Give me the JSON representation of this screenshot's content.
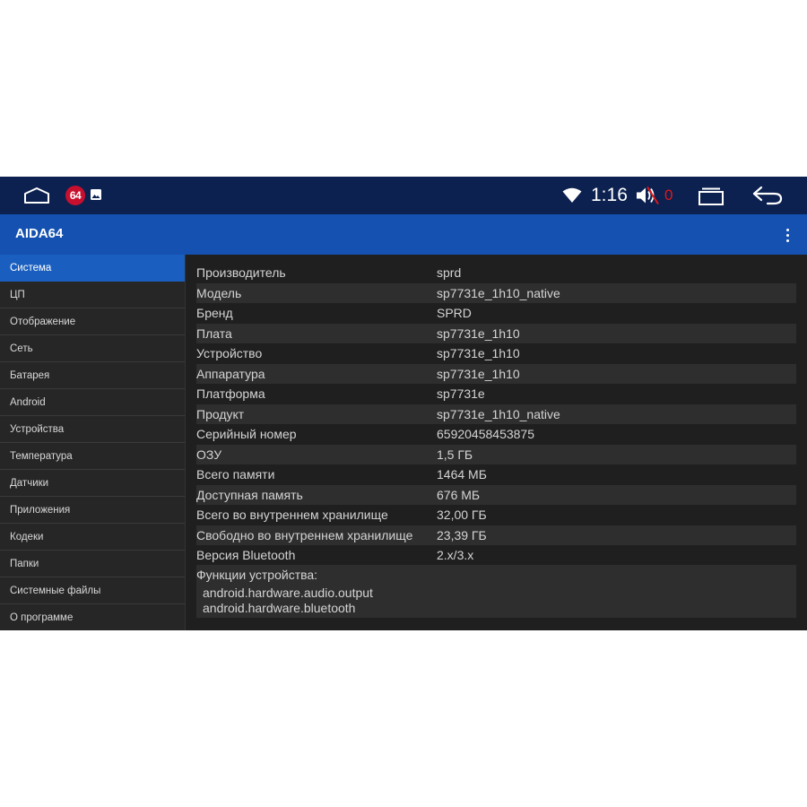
{
  "status_bar": {
    "notification_badge": "64",
    "time": "1:16",
    "volume_count": "0",
    "icons": [
      "home-icon",
      "aida64-notification-icon",
      "gallery-icon",
      "wifi-icon",
      "volume-muted-icon",
      "recents-icon",
      "back-icon"
    ],
    "colors": {
      "bar": "#0c2150",
      "badge": "#c8102e",
      "volume_count": "#e01818"
    }
  },
  "app_bar": {
    "title": "AIDA64",
    "overflow_icon": "more-vert-icon",
    "color": "#1451b0"
  },
  "sidebar": {
    "active_index": 0,
    "items": [
      "Система",
      "ЦП",
      "Отображение",
      "Сеть",
      "Батарея",
      "Android",
      "Устройства",
      "Температура",
      "Датчики",
      "Приложения",
      "Кодеки",
      "Папки",
      "Системные файлы",
      "О программе"
    ],
    "active_color": "#1a5fbf"
  },
  "system_info": {
    "rows": [
      {
        "key": "Производитель",
        "value": "sprd"
      },
      {
        "key": "Модель",
        "value": "sp7731e_1h10_native"
      },
      {
        "key": "Бренд",
        "value": "SPRD"
      },
      {
        "key": "Плата",
        "value": "sp7731e_1h10"
      },
      {
        "key": "Устройство",
        "value": "sp7731e_1h10"
      },
      {
        "key": "Аппаратура",
        "value": "sp7731e_1h10"
      },
      {
        "key": "Платформа",
        "value": "sp7731e"
      },
      {
        "key": "Продукт",
        "value": "sp7731e_1h10_native"
      },
      {
        "key": "Серийный номер",
        "value": "65920458453875"
      },
      {
        "key": "ОЗУ",
        "value": "1,5 ГБ"
      },
      {
        "key": "Всего памяти",
        "value": "1464 МБ"
      },
      {
        "key": "Доступная память",
        "value": "676 МБ"
      },
      {
        "key": "Всего во внутреннем хранилище",
        "value": "32,00 ГБ"
      },
      {
        "key": "Свободно во внутреннем хранилище",
        "value": "23,39 ГБ"
      },
      {
        "key": "Версия Bluetooth",
        "value": "2.x/3.x"
      }
    ],
    "features_title": "Функции устройства:",
    "features": [
      "android.hardware.audio.output",
      "android.hardware.bluetooth"
    ]
  }
}
